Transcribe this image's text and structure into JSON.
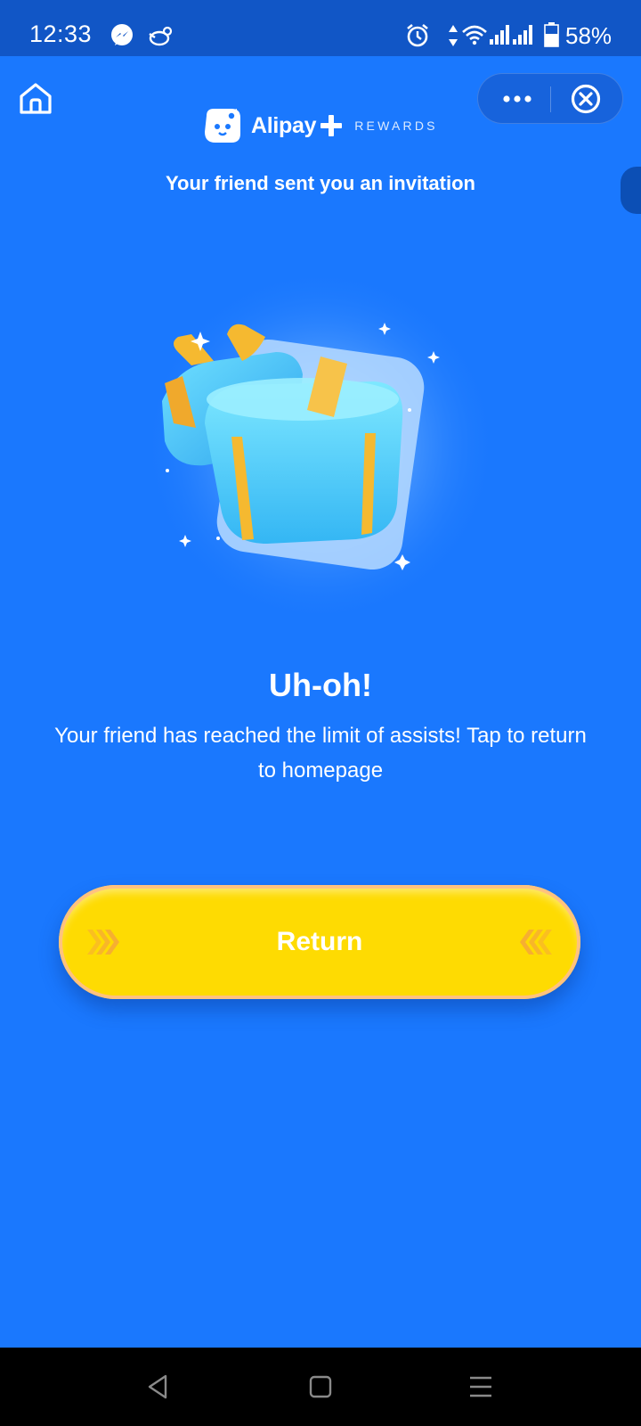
{
  "status_bar": {
    "time": "12:33",
    "battery": "58%",
    "icons": [
      "messenger-icon",
      "bird-app-icon",
      "alarm-icon",
      "data-arrows-icon",
      "wifi-icon",
      "signal-icon",
      "signal-icon",
      "battery-icon"
    ]
  },
  "header": {
    "brand_name": "Alipay",
    "brand_sub": "REWARDS",
    "home_icon": "home-icon",
    "more_icon": "more-dots-icon",
    "close_icon": "close-circle-icon"
  },
  "main": {
    "invite_title": "Your friend sent you an invitation",
    "illustration": "open-gift-box",
    "title": "Uh-oh!",
    "message": "Your friend has reached the limit of assists! Tap to return to homepage",
    "return_label": "Return"
  },
  "nav": {
    "icons": [
      "back-icon",
      "home-square-icon",
      "recents-menu-icon"
    ]
  },
  "colors": {
    "background": "#1a78fe",
    "status_bar": "#1156c6",
    "button": "#fedb02",
    "nav_bar": "#000000"
  }
}
